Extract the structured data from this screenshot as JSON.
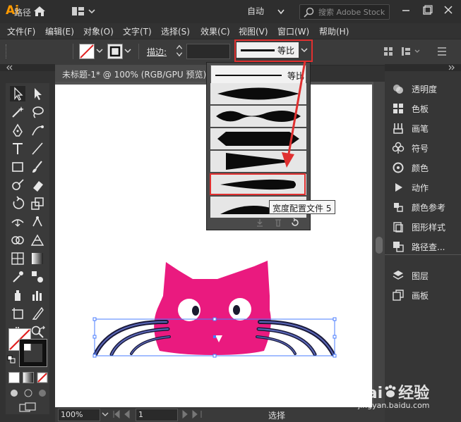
{
  "app": {
    "logo_text": "Ai",
    "workspace_label": "自动",
    "search_placeholder": "搜索 Adobe Stock"
  },
  "menu": {
    "items": [
      "文件(F)",
      "编辑(E)",
      "对象(O)",
      "文字(T)",
      "选择(S)",
      "效果(C)",
      "视图(V)",
      "窗口(W)",
      "帮助(H)"
    ]
  },
  "control_bar": {
    "selection_type": "路径",
    "stroke_label": "描边",
    "stroke_colon": ":",
    "width_profile_label": "等比"
  },
  "document": {
    "tab_title": "未标题-1* @ 100% (RGB/GPU 预览)",
    "zoom": "100%",
    "page": "1",
    "status": "选择"
  },
  "profile_dropdown": {
    "items": [
      {
        "name": "uniform",
        "label": "等比"
      },
      {
        "name": "profile-1"
      },
      {
        "name": "profile-2"
      },
      {
        "name": "profile-3"
      },
      {
        "name": "profile-4"
      },
      {
        "name": "profile-5"
      },
      {
        "name": "profile-6"
      }
    ],
    "tooltip": "宽度配置文件 5"
  },
  "right_panels": [
    {
      "icon": "transparency-icon",
      "label": "透明度"
    },
    {
      "icon": "color-guide-swatch-icon",
      "label": "色板"
    },
    {
      "icon": "brush-icon",
      "label": "画笔"
    },
    {
      "icon": "club-symbol-icon",
      "label": "符号"
    },
    {
      "icon": "color-icon",
      "label": "颜色"
    },
    {
      "icon": "play-icon",
      "label": "动作"
    },
    {
      "icon": "color-guide-icon",
      "label": "颜色参考"
    },
    {
      "icon": "graphic-styles-icon",
      "label": "图形样式"
    },
    {
      "icon": "pathfinder-icon",
      "label": "路径查..."
    },
    {
      "icon": "layers-icon",
      "label": "图层"
    },
    {
      "icon": "artboards-icon",
      "label": "画板"
    }
  ],
  "colors": {
    "cat_pink": "#ea1a7f",
    "accent_orange": "#ff9a00",
    "highlight_red": "#e03030"
  },
  "watermark": {
    "brand": "Bai",
    "brand_rest": "经验",
    "url": "jingyan.baidu.com"
  }
}
